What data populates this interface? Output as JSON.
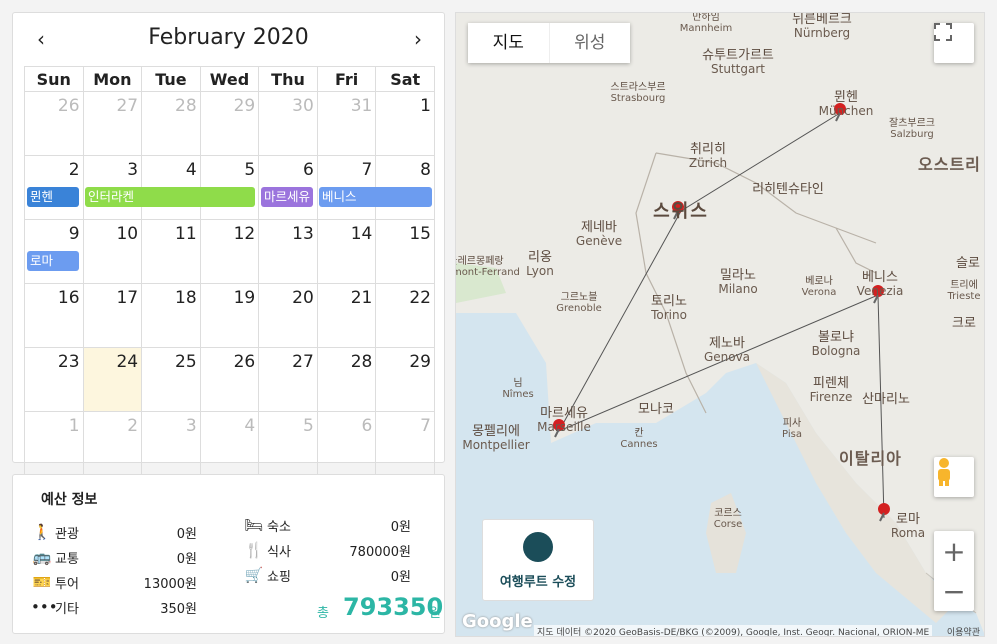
{
  "calendar": {
    "title": "February 2020",
    "prev_label": "‹",
    "next_label": "›",
    "weekdays": [
      "Sun",
      "Mon",
      "Tue",
      "Wed",
      "Thu",
      "Fri",
      "Sat"
    ],
    "weeks": [
      [
        "26",
        "27",
        "28",
        "29",
        "30",
        "31",
        "1"
      ],
      [
        "2",
        "3",
        "4",
        "5",
        "6",
        "7",
        "8"
      ],
      [
        "9",
        "10",
        "11",
        "12",
        "13",
        "14",
        "15"
      ],
      [
        "16",
        "17",
        "18",
        "19",
        "20",
        "21",
        "22"
      ],
      [
        "23",
        "24",
        "25",
        "26",
        "27",
        "28",
        "29"
      ],
      [
        "1",
        "2",
        "3",
        "4",
        "5",
        "6",
        "7"
      ]
    ],
    "events": [
      {
        "label": "뮌헨",
        "color": "#3a83d8"
      },
      {
        "label": "인터라켄",
        "color": "#8fdc4a"
      },
      {
        "label": "마르세유",
        "color": "#9b74dd"
      },
      {
        "label": "베니스",
        "color": "#6c9cf0"
      },
      {
        "label": "로마",
        "color": "#6c9cf0"
      }
    ]
  },
  "budget": {
    "title": "예산 정보",
    "items": [
      {
        "icon": "walking-icon",
        "label": "관광",
        "value": "0원"
      },
      {
        "icon": "bus-icon",
        "label": "교통",
        "value": "0원"
      },
      {
        "icon": "ticket-icon",
        "label": "투어",
        "value": "13000원"
      },
      {
        "icon": "more-icon",
        "label": "기타",
        "value": "350원"
      },
      {
        "icon": "bed-icon",
        "label": "숙소",
        "value": "0원"
      },
      {
        "icon": "utensils-icon",
        "label": "식사",
        "value": "780000원"
      },
      {
        "icon": "cart-icon",
        "label": "쇼핑",
        "value": "0원"
      }
    ],
    "total_label": "총",
    "total_value": "793350",
    "total_unit": "원"
  },
  "map": {
    "tab_map": "지도",
    "tab_satellite": "위성",
    "route_button": "여행루트 수정",
    "google": "Google",
    "attribution": "지도 데이터 ©2020 GeoBasis-DE/BKG (©2009), Google, Inst. Geogr. Nacional, ORION-ME",
    "terms": "이용약관",
    "country": "이탈리아",
    "austria": "오스트리",
    "cities": [
      {
        "ko": "뮌헨",
        "en": "München"
      },
      {
        "ko": "스위스",
        "en": ""
      },
      {
        "ko": "베니스",
        "en": "Venezia"
      },
      {
        "ko": "마르세유",
        "en": "Marseille"
      },
      {
        "ko": "로마",
        "en": "Roma"
      },
      {
        "ko": "취리히",
        "en": "Zürich"
      },
      {
        "ko": "슈투트가르트",
        "en": "Stuttgart"
      },
      {
        "ko": "스트라스부르",
        "en": "Strasbourg"
      },
      {
        "ko": "제네바",
        "en": "Genève"
      },
      {
        "ko": "리옹",
        "en": "Lyon"
      },
      {
        "ko": "밀라노",
        "en": "Milano"
      },
      {
        "ko": "토리노",
        "en": "Torino"
      },
      {
        "ko": "제노바",
        "en": "Genova"
      },
      {
        "ko": "볼로냐",
        "en": "Bologna"
      },
      {
        "ko": "피렌체",
        "en": "Firenze"
      },
      {
        "ko": "몽펠리에",
        "en": "Montpellier"
      },
      {
        "ko": "리히텐슈타인",
        "en": ""
      },
      {
        "ko": "그르노블",
        "en": "Grenoble"
      },
      {
        "ko": "베로나",
        "en": "Verona"
      },
      {
        "ko": "잘츠부르크",
        "en": "Salzburg"
      },
      {
        "ko": "칸",
        "en": "Cannes"
      },
      {
        "ko": "모나코",
        "en": ""
      },
      {
        "ko": "님",
        "en": "Nîmes"
      },
      {
        "ko": "산마리노",
        "en": ""
      },
      {
        "ko": "코르스",
        "en": "Corse"
      },
      {
        "ko": "피사",
        "en": "Pisa"
      },
      {
        "ko": "뉘른베르크",
        "en": "Nürnberg"
      },
      {
        "ko": "만하임",
        "en": "Mannheim"
      },
      {
        "ko": "슬로",
        "en": ""
      },
      {
        "ko": "트리에",
        "en": "Trieste"
      },
      {
        "ko": "크로",
        "en": ""
      },
      {
        "ko": "클레르몽페랑",
        "en": "Clermont-Ferrand"
      }
    ]
  }
}
